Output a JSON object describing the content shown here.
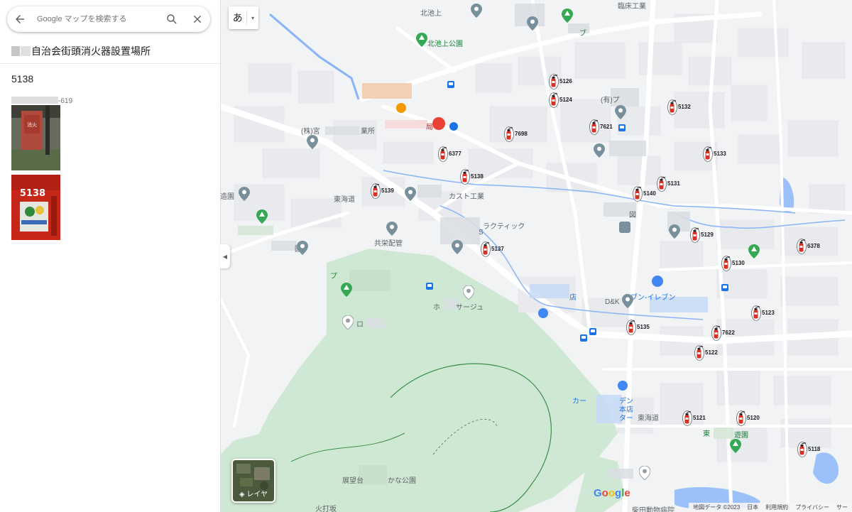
{
  "search": {
    "placeholder": "Google マップを検索する"
  },
  "place": {
    "title": "自治会街頭消火器設置場所",
    "number": "5138",
    "photo_caption": "-619",
    "photo2_number": "5138",
    "photo1_sign": "消火"
  },
  "controls": {
    "ime_char": "あ",
    "layer_label": "レイヤ"
  },
  "logo": {
    "G": "G",
    "o1": "o",
    "o2": "o",
    "g": "g",
    "l": "l",
    "e": "e"
  },
  "attribution": [
    "地図データ ©2023",
    "日本",
    "利用規約",
    "プライバシー",
    "サー"
  ],
  "map_labels": [
    {
      "text": "北池上",
      "style": "",
      "pos": "kitaikegami"
    },
    {
      "text": "北池上公園",
      "style": "green",
      "pos": "park1"
    },
    {
      "text": "(株)宮",
      "style": "",
      "pos": "miya"
    },
    {
      "text": "業所",
      "style": "",
      "pos": "gyosho"
    },
    {
      "text": "造園",
      "style": "",
      "pos": "zoen"
    },
    {
      "text": "東海道",
      "style": "",
      "pos": "tokaido"
    },
    {
      "text": "共栄配管",
      "style": "",
      "pos": "kyoei"
    },
    {
      "text": "園",
      "style": "",
      "pos": "en"
    },
    {
      "text": "ロ",
      "style": "",
      "pos": "ro"
    },
    {
      "text": "サージュ",
      "style": "",
      "pos": "sage"
    },
    {
      "text": "ホ",
      "style": "",
      "pos": "ho"
    },
    {
      "text": "局",
      "style": "red",
      "pos": "kyoku"
    },
    {
      "text": "カスト工業",
      "style": "",
      "pos": "kasuto"
    },
    {
      "text": "ラクティック",
      "style": "",
      "pos": "ractic"
    },
    {
      "text": "S",
      "style": "",
      "pos": "s"
    },
    {
      "text": "D&K",
      "style": "",
      "pos": "dk"
    },
    {
      "text": "セブン-イレブン",
      "style": "blue",
      "pos": "seven"
    },
    {
      "text": "店",
      "style": "blue",
      "pos": "ten"
    },
    {
      "text": "カー",
      "style": "blue",
      "pos": "car"
    },
    {
      "text": "デン",
      "style": "blue",
      "pos": "den"
    },
    {
      "text": "本店",
      "style": "blue",
      "pos": "honten"
    },
    {
      "text": "ター",
      "style": "blue",
      "pos": "ta"
    },
    {
      "text": "東海道",
      "style": "",
      "pos": "tokaido2"
    },
    {
      "text": "東",
      "style": "green",
      "pos": "higashi"
    },
    {
      "text": "遊園",
      "style": "green",
      "pos": "yuen"
    },
    {
      "text": "展望台",
      "style": "",
      "pos": "tenbo"
    },
    {
      "text": "かな公園",
      "style": "",
      "pos": "kanapark"
    },
    {
      "text": "火打坂",
      "style": "",
      "pos": "hiuchi"
    },
    {
      "text": "柴田動物病院",
      "style": "",
      "pos": "shibata"
    },
    {
      "text": "臨床工業",
      "style": "",
      "pos": "rinsho"
    },
    {
      "text": "プ",
      "style": "green",
      "pos": "pu"
    },
    {
      "text": "ブ",
      "style": "green",
      "pos": "bu"
    },
    {
      "text": "(有)プ",
      "style": "",
      "pos": "yu"
    },
    {
      "text": "図",
      "style": "",
      "pos": "zu"
    }
  ],
  "extinguishers": [
    {
      "number": "5126"
    },
    {
      "number": "5124"
    },
    {
      "number": "5132"
    },
    {
      "number": "7621"
    },
    {
      "number": "7698"
    },
    {
      "number": "6377"
    },
    {
      "number": "5133"
    },
    {
      "number": "5138"
    },
    {
      "number": "5131"
    },
    {
      "number": "5139"
    },
    {
      "number": "5140"
    },
    {
      "number": "5129"
    },
    {
      "number": "6378"
    },
    {
      "number": "5137"
    },
    {
      "number": "5130"
    },
    {
      "number": "5123"
    },
    {
      "number": "5135"
    },
    {
      "number": "7622"
    },
    {
      "number": "5122"
    },
    {
      "number": "5121"
    },
    {
      "number": "5120"
    },
    {
      "number": "5118"
    }
  ]
}
